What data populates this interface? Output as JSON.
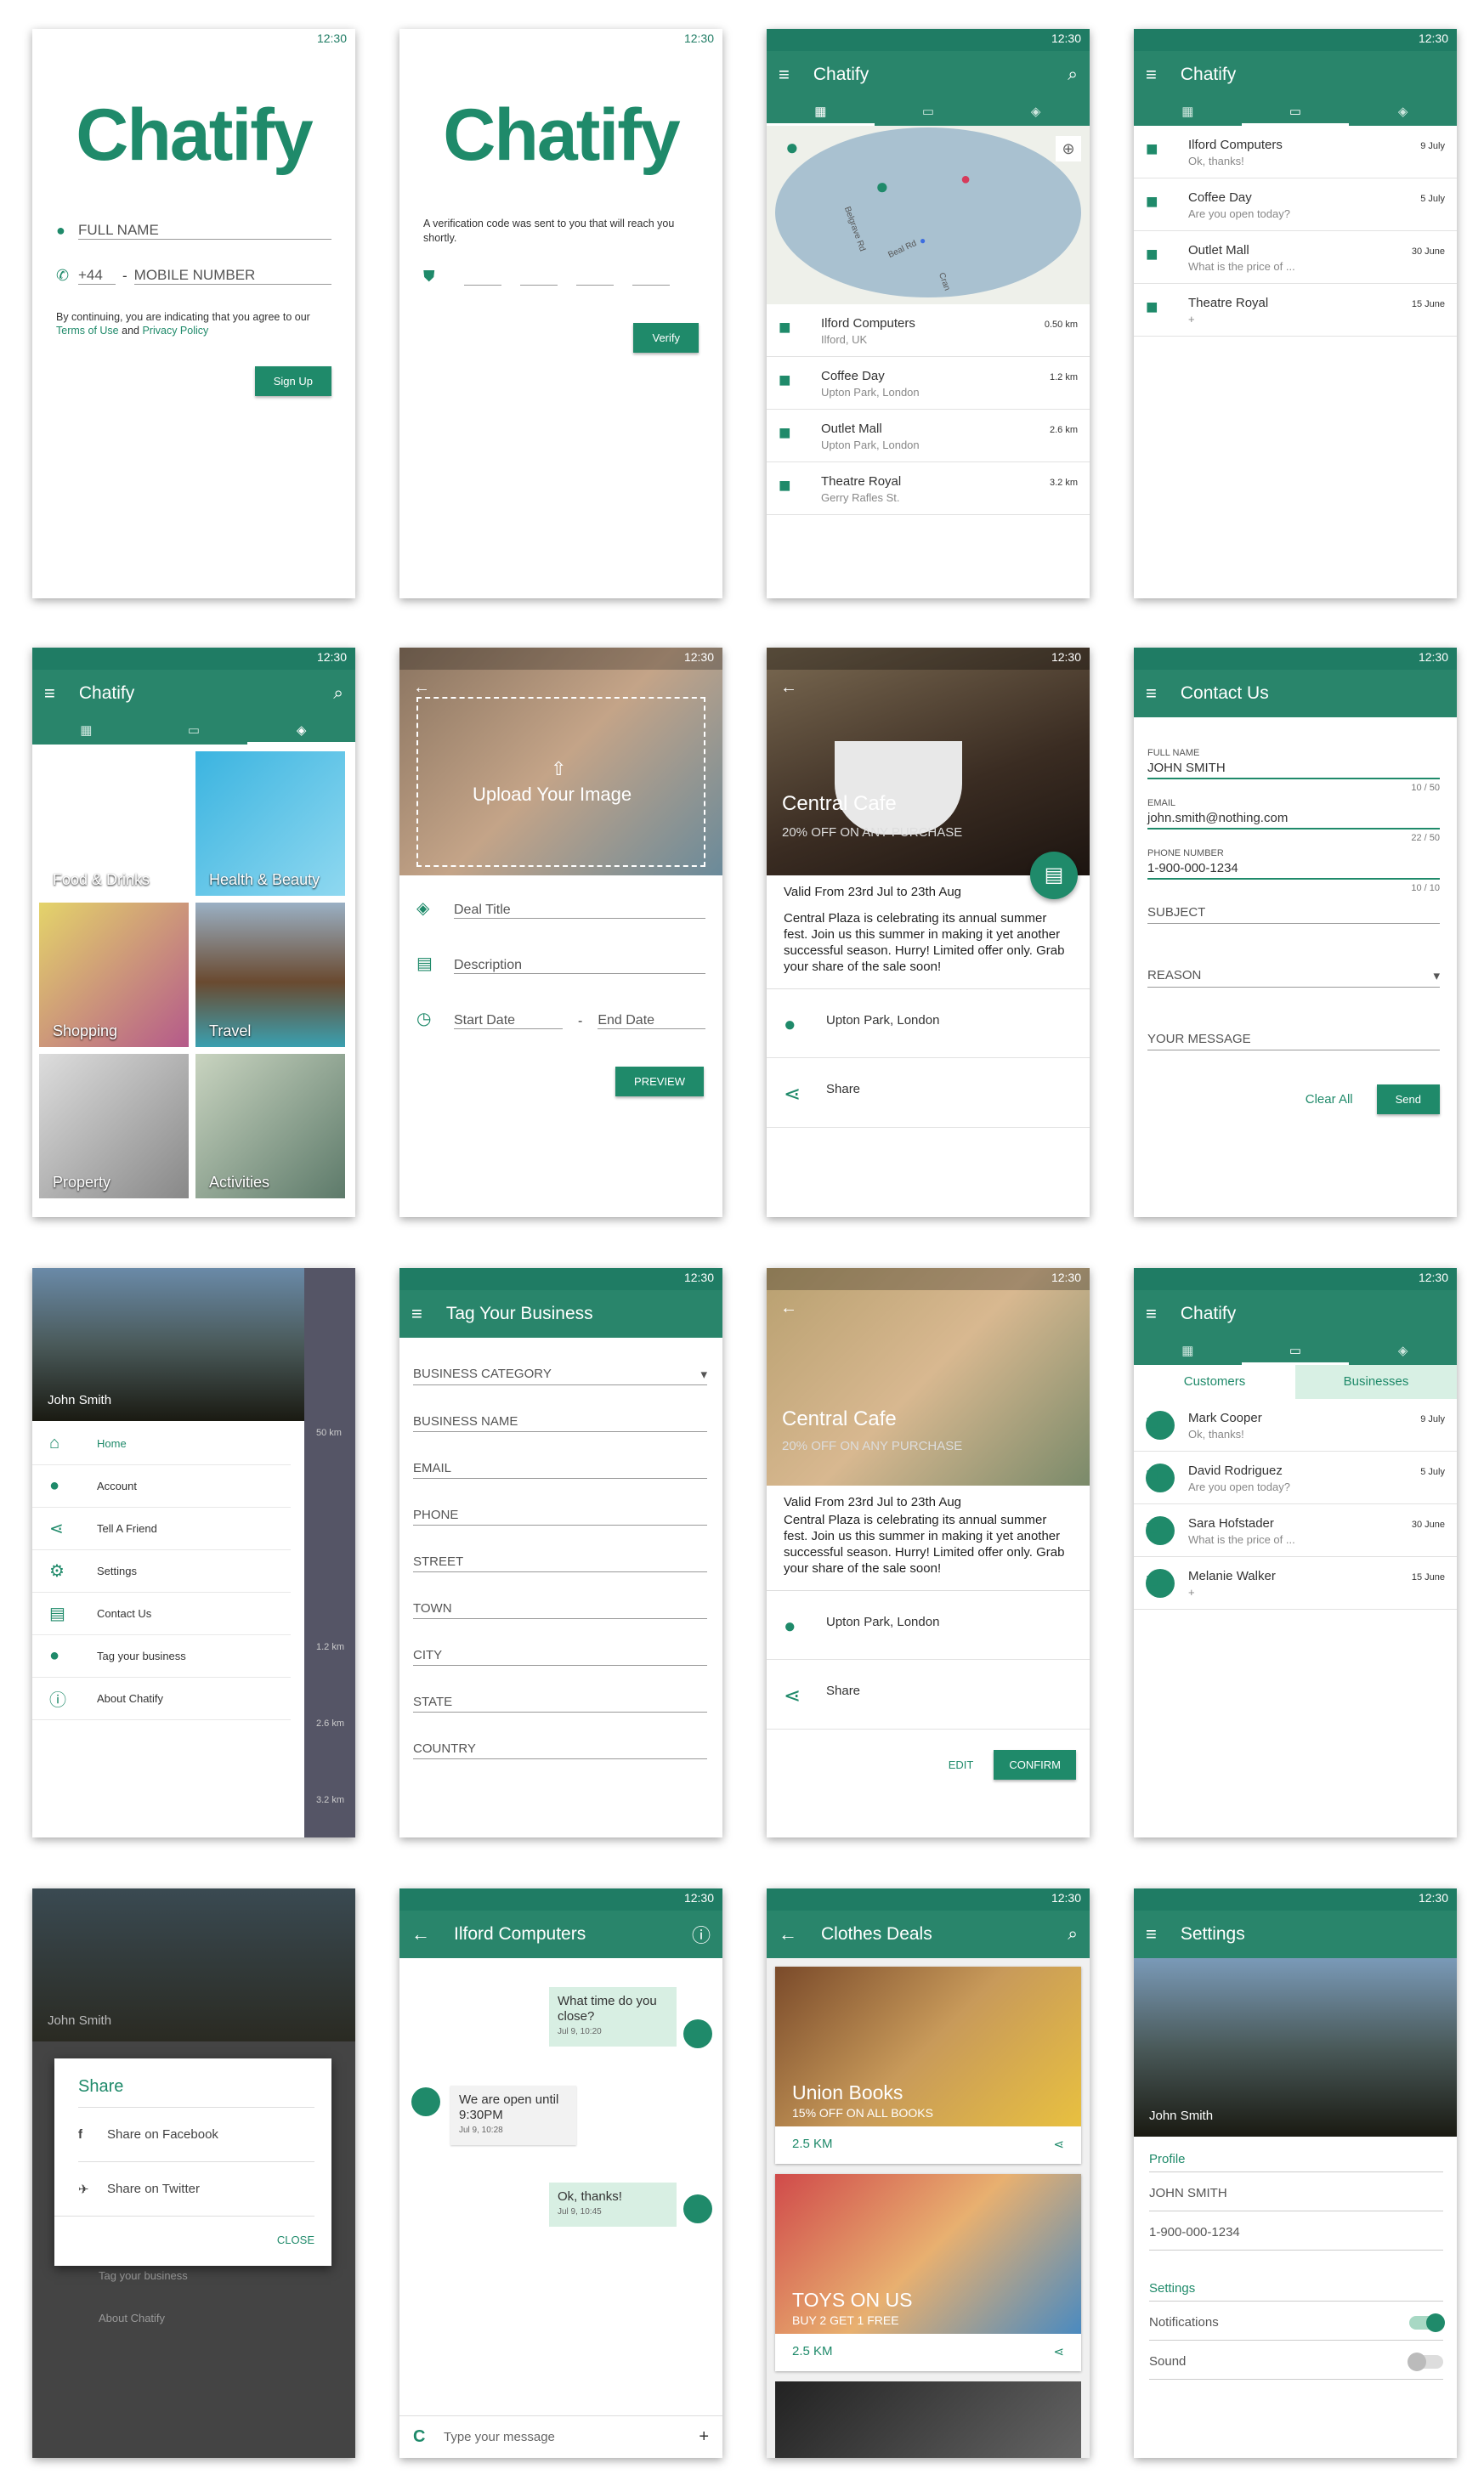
{
  "status": {
    "time": "12:30"
  },
  "s1": {
    "logo": "Chatify",
    "name": "FULL NAME",
    "code": "+44",
    "dash": "-",
    "mobile": "MOBILE NUMBER",
    "terms1": "By continuing, you are indicating that you agree to our",
    "terms_link": "Terms of Use",
    "and": "and",
    "privacy": "Privacy Policy",
    "btn": "Sign Up"
  },
  "s2": {
    "logo": "Chatify",
    "msg": "A verification code was sent to you that will reach you shortly.",
    "btn": "Verify"
  },
  "s3": {
    "title": "Chatify",
    "items": [
      {
        "t": "Ilford Computers",
        "s": "Ilford, UK",
        "d": "0.50 km"
      },
      {
        "t": "Coffee Day",
        "s": "Upton Park, London",
        "d": "1.2 km"
      },
      {
        "t": "Outlet Mall",
        "s": "Upton Park, London",
        "d": "2.6 km"
      },
      {
        "t": "Theatre Royal",
        "s": "Gerry Rafles St.",
        "d": "3.2 km"
      }
    ],
    "map_roads": [
      "Belgrave Rd",
      "Beal Rd",
      "Cran"
    ]
  },
  "s4": {
    "title": "Chatify",
    "items": [
      {
        "t": "Ilford Computers",
        "s": "Ok, thanks!",
        "d": "9 July"
      },
      {
        "t": "Coffee Day",
        "s": "Are you open today?",
        "d": "5 July"
      },
      {
        "t": "Outlet Mall",
        "s": "What is the price of ...",
        "d": "30 June"
      },
      {
        "t": "Theatre Royal",
        "s": "+",
        "d": "15 June"
      }
    ]
  },
  "s5": {
    "title": "Chatify",
    "tiles": [
      "Food & Drinks",
      "Health & Beauty",
      "Shopping",
      "Travel",
      "Property",
      "Activities"
    ]
  },
  "s6": {
    "upload": "Upload Your Image",
    "deal": "Deal Title",
    "desc": "Description",
    "start": "Start Date",
    "dash": "-",
    "end": "End Date",
    "btn": "PREVIEW"
  },
  "s7": {
    "title": "Central Cafe",
    "sub": "20% OFF ON ANY PURCHASE",
    "valid": "Valid From 23rd Jul to 23th Aug",
    "body": "Central Plaza is celebrating its annual summer fest. Join us this summer in making it yet another successful season. Hurry! Limited offer only. Grab your share of the sale soon!",
    "loc": "Upton Park, London",
    "share": "Share"
  },
  "s8": {
    "title": "Contact Us",
    "name_lbl": "FULL NAME",
    "name": "JOHN SMITH",
    "c1": "10 / 50",
    "email_lbl": "EMAIL",
    "email": "john.smith@nothing.com",
    "c2": "22 / 50",
    "phone_lbl": "PHONE NUMBER",
    "phone": "1-900-000-1234",
    "c3": "10 / 10",
    "subject": "SUBJECT",
    "reason": "REASON",
    "message": "YOUR MESSAGE",
    "clear": "Clear All",
    "send": "Send"
  },
  "s9": {
    "user": "John Smith",
    "items": [
      "Home",
      "Account",
      "Tell A Friend",
      "Settings",
      "Contact Us",
      "Tag your business",
      "About Chatify"
    ],
    "bg": [
      "50 km",
      "1.2 km",
      "2.6 km",
      "3.2 km"
    ]
  },
  "s10": {
    "title": "Tag Your Business",
    "fields": [
      "BUSINESS CATEGORY",
      "BUSINESS NAME",
      "EMAIL",
      "PHONE",
      "STREET",
      "TOWN",
      "CITY",
      "STATE",
      "COUNTRY"
    ]
  },
  "s11": {
    "title": "Central Cafe",
    "sub": "20% OFF ON ANY PURCHASE",
    "valid": "Valid From 23rd Jul to 23th Aug",
    "body": "Central Plaza is celebrating its annual summer fest. Join us this summer in making it yet another successful season. Hurry! Limited offer only. Grab your share of the sale soon!",
    "loc": "Upton Park, London",
    "share": "Share",
    "edit": "EDIT",
    "confirm": "CONFIRM"
  },
  "s12": {
    "title": "Chatify",
    "tab1": "Customers",
    "tab2": "Businesses",
    "items": [
      {
        "t": "Mark Cooper",
        "s": "Ok, thanks!",
        "d": "9 July"
      },
      {
        "t": "David Rodriguez",
        "s": "Are you open today?",
        "d": "5 July"
      },
      {
        "t": "Sara Hofstader",
        "s": "What is the price of ...",
        "d": "30 June"
      },
      {
        "t": "Melanie Walker",
        "s": "+",
        "d": "15 June"
      }
    ]
  },
  "s13": {
    "user": "John Smith",
    "title": "Share",
    "fb": "Share on Facebook",
    "tw": "Share on Twitter",
    "close": "CLOSE",
    "bg1": "Tag your business",
    "bg2": "About Chatify"
  },
  "s14": {
    "title": "Ilford Computers",
    "m1": "What time do you close?",
    "t1": "Jul 9, 10:20",
    "m2": "We are open until 9:30PM",
    "t2": "Jul 9, 10:28",
    "m3": "Ok, thanks!",
    "t3": "Jul 9, 10:45",
    "input": "Type your message",
    "c": "C",
    "plus": "+"
  },
  "s15": {
    "title": "Clothes Deals",
    "cards": [
      {
        "t": "Union Books",
        "s": "15% OFF ON ALL BOOKS",
        "d": "2.5 KM"
      },
      {
        "t": "TOYS ON US",
        "s": "BUY 2 GET 1 FREE",
        "d": "2.5 KM"
      }
    ]
  },
  "s16": {
    "title": "Settings",
    "user": "John Smith",
    "profile": "Profile",
    "name": "JOHN SMITH",
    "phone": "1-900-000-1234",
    "settings": "Settings",
    "notif": "Notifications",
    "sound": "Sound"
  }
}
